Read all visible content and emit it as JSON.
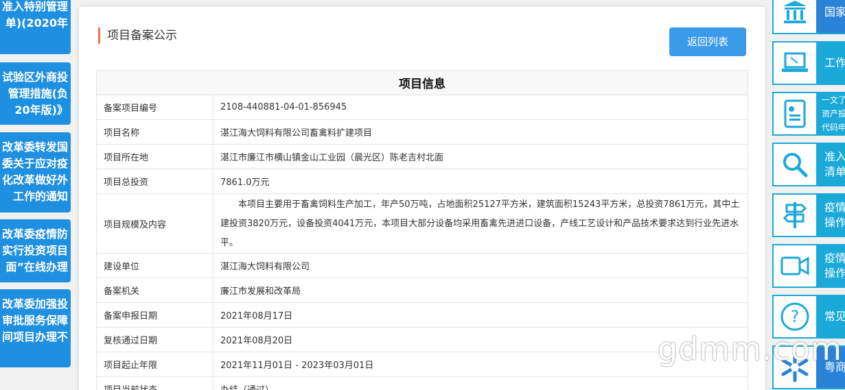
{
  "left_sidebar": {
    "cards": [
      {
        "lines": [
          "准入特别管理",
          "单)(2020年"
        ]
      },
      {
        "lines": [
          "试验区外商投",
          "管理措施(负",
          "20年版)》"
        ]
      },
      {
        "lines": [
          "改革委转发国",
          "委关于应对疫",
          "化改革做好外",
          "工作的通知"
        ]
      },
      {
        "lines": [
          "改革委疫情防",
          "实行投资项目",
          "面”在线办理"
        ]
      },
      {
        "lines": [
          "改革委加强投",
          "审批服务保障",
          "间项目办理不"
        ]
      }
    ]
  },
  "main": {
    "title": "项目备案公示",
    "back_button": "返回列表",
    "table_caption": "项目信息",
    "rows": [
      {
        "label": "备案项目编号",
        "value": "2108-440881-04-01-856945"
      },
      {
        "label": "项目名称",
        "value": "湛江海大饲料有限公司畜禽料扩建项目"
      },
      {
        "label": "项目所在地",
        "value": "湛江市廉江市横山镇金山工业园（晨光区）陈老吉村北面"
      },
      {
        "label": "项目总投资",
        "value": "7861.0万元"
      },
      {
        "label": "项目规模及内容",
        "value": "本项目主要用于畜禽饲料生产加工，年产50万吨，占地面积25127平方米，建筑面积15243平方米，总投资7861万元，其中土建投资3820万元，设备投资4041万元，本项目大部分设备均采用畜禽先进进口设备，产线工艺设计和产品技术要求达到行业先进水平。"
      },
      {
        "label": "建设单位",
        "value": "湛江海大饲料有限公司"
      },
      {
        "label": "备案机关",
        "value": "廉江市发展和改革局"
      },
      {
        "label": "备案申报日期",
        "value": "2021年08月17日"
      },
      {
        "label": "复核通过日期",
        "value": "2021年08月20日"
      },
      {
        "label": "项目起止年限",
        "value": "2021年11月01日 - 2023年03月01日"
      },
      {
        "label": "项目当前状态",
        "value": "办结（通过）"
      }
    ]
  },
  "right_sidebar": {
    "cards": [
      {
        "icon": "bank-icon",
        "lines": [
          "国家"
        ]
      },
      {
        "icon": "laptop-icon",
        "lines": [
          "工作"
        ]
      },
      {
        "icon": "document-icon",
        "lines": [
          "一文了",
          "资产投",
          "代码申"
        ]
      },
      {
        "icon": "search-icon",
        "lines": [
          "准入",
          "清单"
        ]
      },
      {
        "icon": "signpost-icon",
        "lines": [
          "疫情期",
          "操作"
        ]
      },
      {
        "icon": "video-icon",
        "lines": [
          "疫情期",
          "操作指"
        ]
      },
      {
        "icon": "question-icon",
        "lines": [
          "常见"
        ]
      },
      {
        "icon": "snowflake-logo-icon",
        "lines": [
          "粤商"
        ]
      }
    ]
  },
  "watermark": "gdmm.com",
  "colors": {
    "accent": "#1e8fe1",
    "title_bar": "#e9724c",
    "button": "#3c9be8",
    "right_accent": "#1aa9d8"
  }
}
